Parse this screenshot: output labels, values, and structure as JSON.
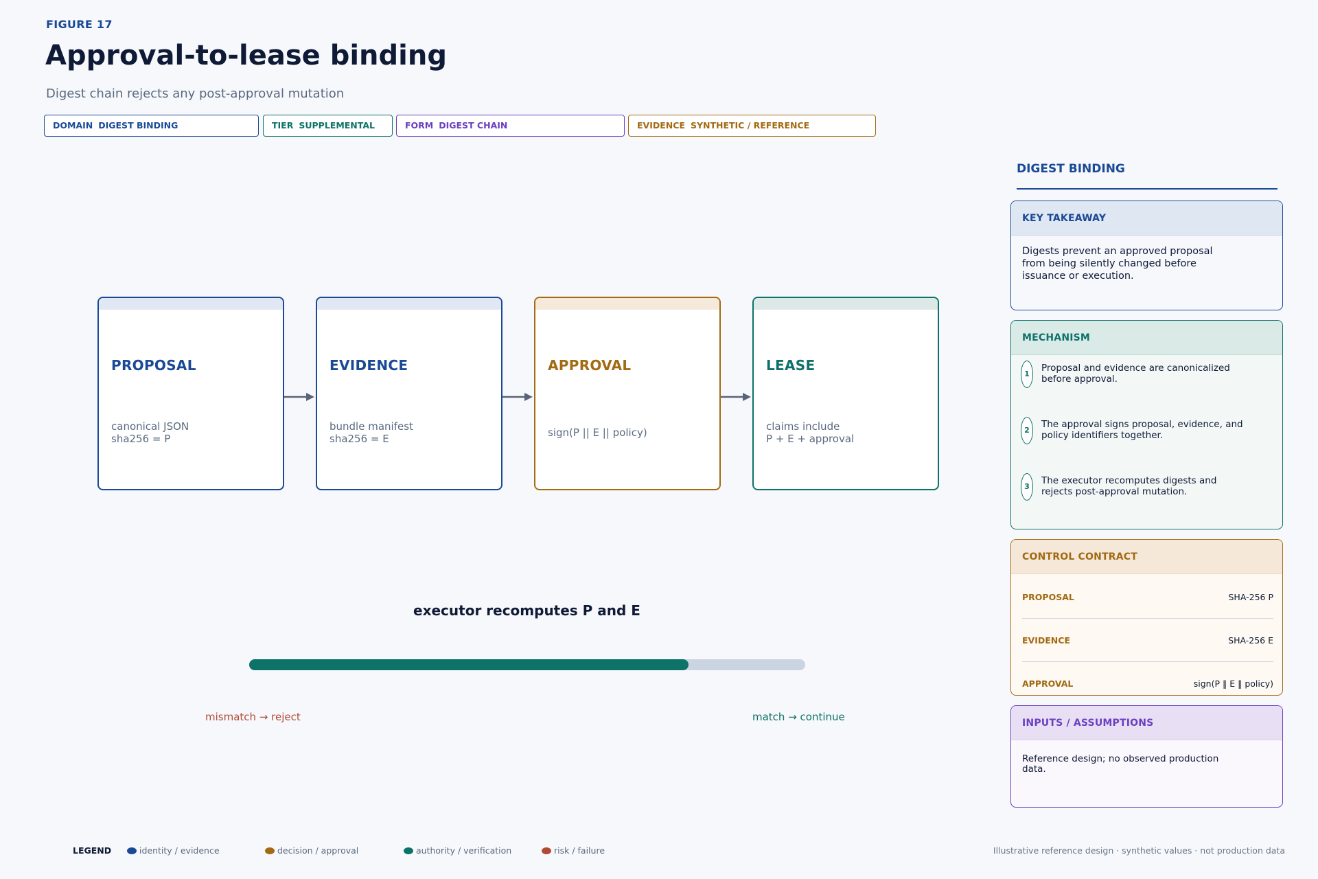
{
  "figure_label": "FIGURE 17",
  "title": "Approval-to-lease binding",
  "subtitle": "Digest chain rejects any post-approval mutation",
  "tags": [
    {
      "key": "DOMAIN",
      "value": "DIGEST BINDING",
      "color": "#1a4a96"
    },
    {
      "key": "TIER",
      "value": "SUPPLEMENTAL",
      "color": "#0d7268"
    },
    {
      "key": "FORM",
      "value": "DIGEST CHAIN",
      "color": "#6a3fc0"
    },
    {
      "key": "EVIDENCE",
      "value": "SYNTHETIC / REFERENCE",
      "color": "#a26a12"
    }
  ],
  "stages": [
    {
      "name": "PROPOSAL",
      "lines": [
        "canonical JSON",
        "sha256 = P"
      ],
      "color": "#1a4a96",
      "band": "#e1e8f3"
    },
    {
      "name": "EVIDENCE",
      "lines": [
        "bundle manifest",
        "sha256 = E"
      ],
      "color": "#1a4a96",
      "band": "#e1e8f3"
    },
    {
      "name": "APPROVAL",
      "lines": [
        "sign(P || E || policy)"
      ],
      "color": "#a26a12",
      "band": "#f5e9da"
    },
    {
      "name": "LEASE",
      "lines": [
        "claims include",
        "P + E + approval"
      ],
      "color": "#0d7268",
      "band": "#dde9e7"
    }
  ],
  "flow": {
    "label": "executor recomputes P and E",
    "progress_fraction": 0.79,
    "left_label": "mismatch → reject",
    "right_label": "match → continue"
  },
  "panel": {
    "heading": "DIGEST BINDING",
    "takeaway": {
      "title": "KEY TAKEAWAY",
      "text": "Digests prevent an approved proposal from being silently changed before issuance or execution."
    },
    "mechanism": {
      "title": "MECHANISM",
      "items": [
        {
          "num": "1",
          "text": "Proposal and evidence are canonicalized before approval."
        },
        {
          "num": "2",
          "text": "The approval signs proposal, evidence, and policy identifiers together."
        },
        {
          "num": "3",
          "text": "The executor recomputes digests and rejects post-approval mutation."
        }
      ]
    },
    "contract": {
      "title": "CONTROL CONTRACT",
      "rows": [
        {
          "key": "PROPOSAL",
          "value": "SHA-256 P"
        },
        {
          "key": "EVIDENCE",
          "value": "SHA-256 E"
        },
        {
          "key": "APPROVAL",
          "value": "sign(P ‖ E ‖ policy)"
        }
      ]
    },
    "inputs": {
      "title": "INPUTS / ASSUMPTIONS",
      "text": "Reference design; no observed production data."
    }
  },
  "legend": {
    "title": "LEGEND",
    "items": [
      {
        "label": "identity / evidence",
        "color": "#1a4a96"
      },
      {
        "label": "decision / approval",
        "color": "#a26a12"
      },
      {
        "label": "authority / verification",
        "color": "#0d7268"
      },
      {
        "label": "risk / failure",
        "color": "#b04a36"
      }
    ]
  },
  "footer": "Illustrative reference design · synthetic values · not production data"
}
